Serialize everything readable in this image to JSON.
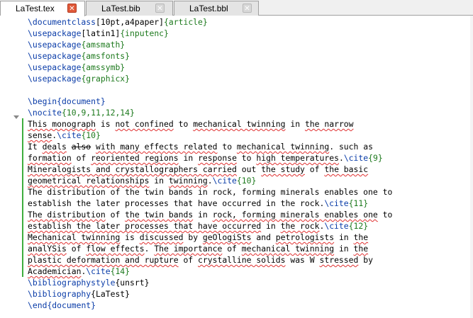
{
  "tabs": [
    {
      "label": "LaTest.tex",
      "active": true
    },
    {
      "label": "LaTest.bib",
      "active": false
    },
    {
      "label": "LaTest.bbl",
      "active": false
    }
  ],
  "editor": {
    "lines": [
      [
        [
          "cmd",
          "\\documentclass"
        ],
        [
          "t",
          "[10pt,a4paper]"
        ],
        [
          "arg",
          "{article}"
        ]
      ],
      [
        [
          "cmd",
          "\\usepackage"
        ],
        [
          "t",
          "[latin1]"
        ],
        [
          "arg",
          "{inputenc}"
        ]
      ],
      [
        [
          "cmd",
          "\\usepackage"
        ],
        [
          "arg",
          "{amsmath}"
        ]
      ],
      [
        [
          "cmd",
          "\\usepackage"
        ],
        [
          "arg",
          "{amsfonts}"
        ]
      ],
      [
        [
          "cmd",
          "\\usepackage"
        ],
        [
          "arg",
          "{amssymb}"
        ]
      ],
      [
        [
          "cmd",
          "\\usepackage"
        ],
        [
          "arg",
          "{graphicx}"
        ]
      ],
      [],
      [
        [
          "cmd",
          "\\begin"
        ],
        [
          "cmd",
          "{document}"
        ]
      ],
      [
        [
          "cmd",
          "\\nocite"
        ],
        [
          "arg",
          "{10,9,11,12,14}"
        ]
      ],
      [
        [
          "sq",
          "This monograph"
        ],
        [
          "t",
          " is "
        ],
        [
          "sq",
          "not confined"
        ],
        [
          "t",
          " to "
        ],
        [
          "sq",
          "mechanical twinning"
        ],
        [
          "t",
          " in "
        ],
        [
          "sq",
          "the narrow"
        ]
      ],
      [
        [
          "sq",
          "sense"
        ],
        [
          "t",
          "."
        ],
        [
          "cmd",
          "\\cite"
        ],
        [
          "arg",
          "{10}"
        ]
      ],
      [
        [
          "t",
          "It "
        ],
        [
          "sq",
          "deals"
        ],
        [
          "t",
          " "
        ],
        [
          "strike",
          "also"
        ],
        [
          "t",
          " "
        ],
        [
          "sq",
          "with many effects related"
        ],
        [
          "t",
          " to "
        ],
        [
          "sq",
          "mechanical twinning"
        ],
        [
          "t",
          ". such as"
        ]
      ],
      [
        [
          "sq",
          "formation"
        ],
        [
          "t",
          " of "
        ],
        [
          "sq",
          "reoriented regions"
        ],
        [
          "t",
          " in "
        ],
        [
          "sq",
          "response"
        ],
        [
          "t",
          " to "
        ],
        [
          "sq",
          "high temperatures"
        ],
        [
          "t",
          "."
        ],
        [
          "cmd",
          "\\cite"
        ],
        [
          "arg",
          "{9}"
        ]
      ],
      [
        [
          "sq",
          "Mineralogists and crystallographers carried"
        ],
        [
          "t",
          " out "
        ],
        [
          "sq",
          "the study"
        ],
        [
          "t",
          " of "
        ],
        [
          "sq",
          "the basic"
        ]
      ],
      [
        [
          "sq",
          "geometrical relationships"
        ],
        [
          "t",
          " in "
        ],
        [
          "sq",
          "twinning"
        ],
        [
          "t",
          "."
        ],
        [
          "cmd",
          "\\cite"
        ],
        [
          "arg",
          "{10}"
        ]
      ],
      [
        [
          "t",
          "The distribution of the twin bands in rock, forming minerals enables one to"
        ]
      ],
      [
        [
          "t",
          "establish the later processes that have occurred in the rock."
        ],
        [
          "cmd",
          "\\cite"
        ],
        [
          "arg",
          "{11}"
        ]
      ],
      [
        [
          "sq",
          "The distribution"
        ],
        [
          "t",
          " of "
        ],
        [
          "sq",
          "the twin bands"
        ],
        [
          "t",
          " in "
        ],
        [
          "sq",
          "rock, forming minerals enables one"
        ],
        [
          "t",
          " to"
        ]
      ],
      [
        [
          "sq",
          "establish the later processes that have occurred"
        ],
        [
          "t",
          " in "
        ],
        [
          "sq",
          "the rock"
        ],
        [
          "t",
          "."
        ],
        [
          "cmd",
          "\\cite"
        ],
        [
          "arg",
          "{12}"
        ]
      ],
      [
        [
          "sq",
          "Mechanical twinning"
        ],
        [
          "t",
          " is "
        ],
        [
          "sq",
          "discussed"
        ],
        [
          "t",
          " by "
        ],
        [
          "sq",
          "geOlogiSts"
        ],
        [
          "t",
          " and "
        ],
        [
          "sq",
          "petrologists"
        ],
        [
          "t",
          " in "
        ],
        [
          "sq",
          "the"
        ]
      ],
      [
        [
          "sq",
          "analYSis"
        ],
        [
          "t",
          " of "
        ],
        [
          "sq",
          "flow effects"
        ],
        [
          "t",
          ". "
        ],
        [
          "sq",
          "The importance"
        ],
        [
          "t",
          " of "
        ],
        [
          "sq",
          "mechanical twinning"
        ],
        [
          "t",
          " in "
        ],
        [
          "sq",
          "the"
        ]
      ],
      [
        [
          "sq",
          "plastic deformation and rupture"
        ],
        [
          "t",
          " of "
        ],
        [
          "sq",
          "crystalline solids"
        ],
        [
          "t",
          " was W "
        ],
        [
          "sq",
          "stressed"
        ],
        [
          "t",
          " by"
        ]
      ],
      [
        [
          "sq",
          "Academician"
        ],
        [
          "t",
          "."
        ],
        [
          "cmd",
          "\\cite"
        ],
        [
          "arg",
          "{14}"
        ]
      ],
      [
        [
          "cmd",
          "\\bibliographystyle"
        ],
        [
          "t",
          "{unsrt}"
        ]
      ],
      [
        [
          "cmd",
          "\\bibliography"
        ],
        [
          "t",
          "{LaTest}"
        ]
      ],
      [
        [
          "cmd",
          "\\end"
        ],
        [
          "cmd",
          "{document}"
        ]
      ]
    ]
  },
  "colors": {
    "command": "#0a3ca8",
    "argument": "#1e7a1e",
    "spellcheck": "#e03030",
    "modified": "#3fae3f",
    "close_active": "#e05a3a"
  },
  "icons": {
    "close_tab": "close-icon",
    "fold": "fold-arrow-icon"
  }
}
